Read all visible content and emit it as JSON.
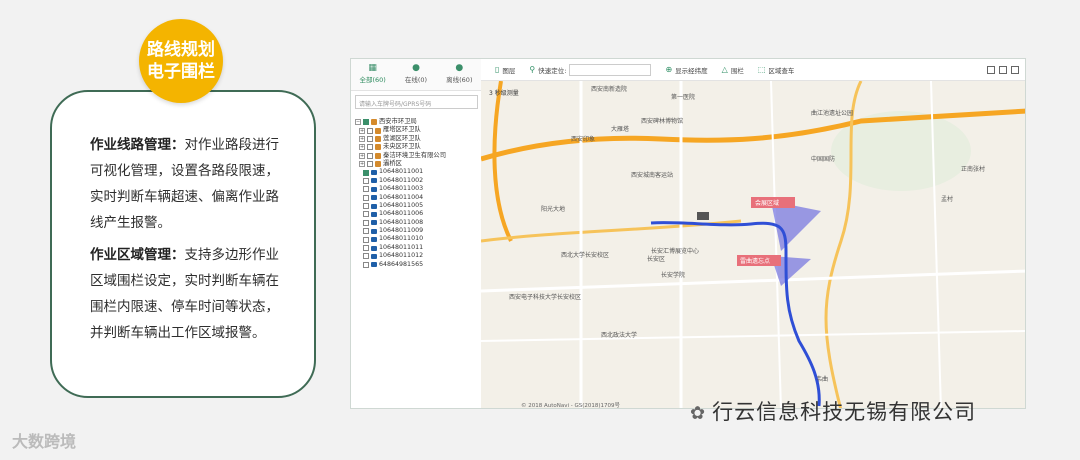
{
  "badge": {
    "line1": "路线规划",
    "line2": "电子围栏"
  },
  "callout": {
    "route_title": "作业线路管理：",
    "route_text": "对作业路段进行可视化管理，设置各路段限速，实时判断车辆超速、偏离作业路线产生报警。",
    "area_title": "作业区域管理：",
    "area_text": "支持多边形作业区域围栏设定，实时判断车辆在围栏内限速、停车时间等状态，并判断车辆出工作区域报警。"
  },
  "app": {
    "tabs": [
      {
        "label": "全部(60)",
        "icon": "grid-icon"
      },
      {
        "label": "在线(0)",
        "icon": "user-icon"
      },
      {
        "label": "离线(60)",
        "icon": "user-offline-icon"
      }
    ],
    "search_placeholder": "请输入车牌号码/GPRS号码",
    "tree": {
      "root": "西安市环卫局",
      "groups": [
        "雁塔区环卫队",
        "莲湖区环卫队",
        "未央区环卫队",
        "秦洁环境卫生有限公司",
        "灞桥区"
      ],
      "vehicles": [
        "10648011001",
        "10648011002",
        "10648011003",
        "10648011004",
        "10648011005",
        "10648011006",
        "10648011008",
        "10648011009",
        "10648011010",
        "10648011011",
        "10648011012",
        "64864981565"
      ]
    },
    "toolbar": {
      "layers": "图层",
      "quick_locate": "快速定位:",
      "show_latlng": "显示经纬度",
      "fence": "围栏",
      "area_query": "区域查车"
    },
    "map": {
      "scale": "3 秒级测量",
      "labels": [
        "西安南新造院",
        "第一医院",
        "西安碑林博物馆",
        "西安印象",
        "曲江池遗址公园",
        "西安城南客运站",
        "阳光大地",
        "长安汇博展览中心",
        "西北大学长安校区",
        "长安区",
        "西安电子科技大学长安校区",
        "西北政法大学",
        "长安学院",
        "大雁塔",
        "中国国防",
        "正南张村",
        "孟村",
        "韦曲"
      ],
      "fence_labels": [
        "会展区域",
        "雷曲遗忘点"
      ],
      "copyright": "© 2018 AutoNavi - GS(2018)1709号",
      "road_tags": [
        "G210",
        "G130",
        "G130",
        "S107",
        "G210"
      ]
    }
  },
  "brand": {
    "company": "行云信息科技无锡有限公司",
    "watermark": "大数跨境"
  },
  "colors": {
    "accent": "#f4b400",
    "border": "#3f6b55",
    "route": "#2f4fd6",
    "fence": "#7070e0"
  }
}
